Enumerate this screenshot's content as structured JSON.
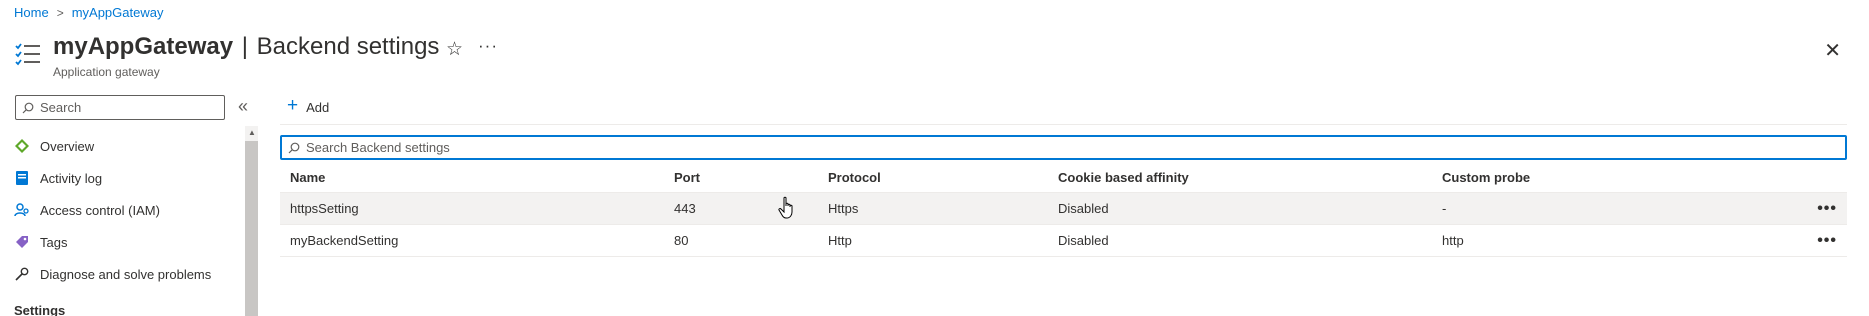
{
  "breadcrumb": {
    "home": "Home",
    "separator": ">",
    "resource": "myAppGateway"
  },
  "header": {
    "resource_name": "myAppGateway",
    "divider": "|",
    "page_name": "Backend settings",
    "subtitle": "Application gateway",
    "star_icon": "star-icon",
    "more_glyph": "···",
    "close_glyph": "✕"
  },
  "sidebar": {
    "search_placeholder": "Search",
    "collapse_glyph": "«",
    "items": [
      {
        "label": "Overview",
        "icon": "overview-icon"
      },
      {
        "label": "Activity log",
        "icon": "activity-log-icon"
      },
      {
        "label": "Access control (IAM)",
        "icon": "iam-icon"
      },
      {
        "label": "Tags",
        "icon": "tag-icon"
      },
      {
        "label": "Diagnose and solve problems",
        "icon": "wrench-icon"
      }
    ],
    "section": "Settings"
  },
  "toolbar": {
    "add_label": "Add",
    "add_glyph": "+"
  },
  "table": {
    "search_placeholder": "Search Backend settings",
    "columns": [
      "Name",
      "Port",
      "Protocol",
      "Cookie based affinity",
      "Custom probe"
    ],
    "rows": [
      {
        "name": "httpsSetting",
        "port": "443",
        "protocol": "Https",
        "affinity": "Disabled",
        "probe": "-"
      },
      {
        "name": "myBackendSetting",
        "port": "80",
        "protocol": "Http",
        "affinity": "Disabled",
        "probe": "http"
      }
    ],
    "row_more_glyph": "•••"
  },
  "colors": {
    "accent": "#0078d4",
    "text": "#323130",
    "muted": "#605e5c",
    "hover_row": "#f3f2f1"
  }
}
